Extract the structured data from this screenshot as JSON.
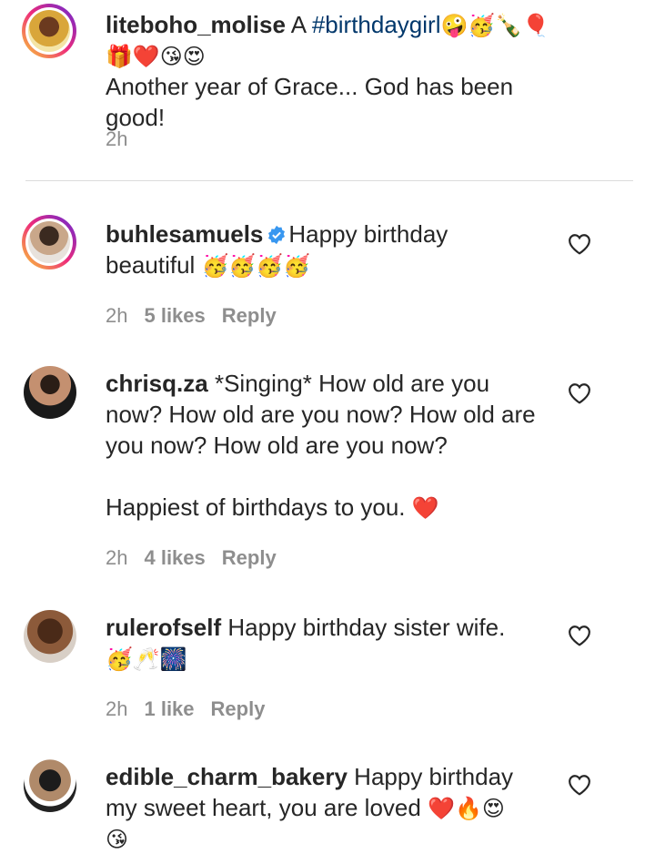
{
  "caption": {
    "username": "liteboho_molise",
    "text_before": " A ",
    "hashtag": "#birthdaygirl",
    "emojis_line1": "🤪🥳🍾🎈",
    "emojis_line2": "🎁❤️😘😍",
    "text_line": "Another year of Grace... God has been good!",
    "time": "2h"
  },
  "comments": [
    {
      "username": "buhlesamuels",
      "verified": true,
      "text": "Happy birthday",
      "text2": "beautiful",
      "emojis": "🥳🥳🥳🥳",
      "time": "2h",
      "likes": "5 likes",
      "reply": "Reply"
    },
    {
      "username": "chrisq.za",
      "text": "*Singing* How old are you",
      "line2": "now? How old are you now? How old are",
      "line3": "you now? How old are you now?",
      "line4": "Happiest of birthdays to you.",
      "emojis": "❤️",
      "time": "2h",
      "likes": "4 likes",
      "reply": "Reply"
    },
    {
      "username": "rulerofself",
      "text": "Happy birthday sister wife.",
      "emojis": "🥳🥂🎆",
      "time": "2h",
      "likes": "1 like",
      "reply": "Reply"
    },
    {
      "username": "edible_charm_bakery",
      "text": "Happy birthday",
      "line2": "my sweet heart, you are loved",
      "emojis": "❤️🔥😍",
      "emojis2": "😘"
    }
  ],
  "icons": {
    "like": "heart-outline-icon",
    "verified": "verified-badge-icon"
  },
  "colors": {
    "hashtag": "#00376b",
    "meta": "#8e8e8e",
    "verified": "#3897f0"
  }
}
